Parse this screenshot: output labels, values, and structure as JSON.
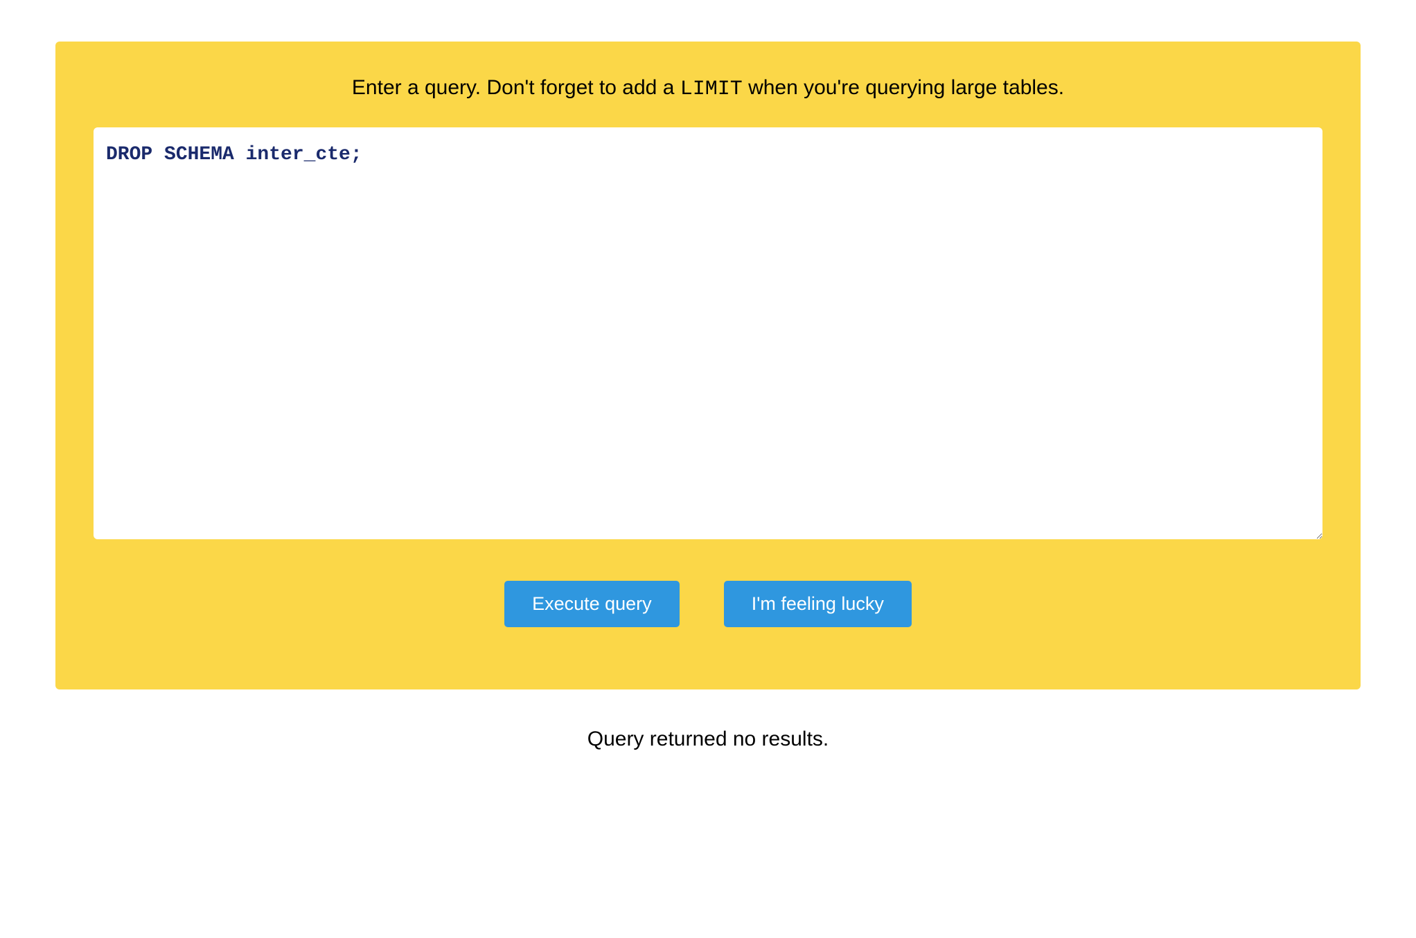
{
  "instructions": {
    "prefix": "Enter a query. Don't forget to add a ",
    "code": "LIMIT",
    "suffix": " when you're querying large tables."
  },
  "query": {
    "value": "DROP SCHEMA inter_cte;"
  },
  "buttons": {
    "execute_label": "Execute query",
    "lucky_label": "I'm feeling lucky"
  },
  "result": {
    "message": "Query returned no results."
  }
}
